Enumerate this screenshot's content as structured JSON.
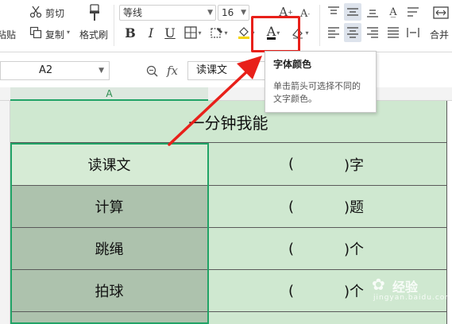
{
  "ribbon": {
    "cut_label": "剪切",
    "paste_label": "粘贴",
    "copy_label": "复制",
    "format_painter_label": "格式刷",
    "font_name": "等线",
    "font_size": "16",
    "merge_label": "合并"
  },
  "tooltip": {
    "title": "字体颜色",
    "description_line1": "单击箭头可选择不同的",
    "description_line2": "文字颜色。"
  },
  "formula_bar": {
    "cell_ref": "A2",
    "formula_value": "读课文"
  },
  "grid": {
    "column_header": "A",
    "title": "一分钟我能",
    "rows": [
      {
        "label": "读课文",
        "left_paren": "(",
        "right_paren_unit": ")字"
      },
      {
        "label": "计算",
        "left_paren": "(",
        "right_paren_unit": ")题"
      },
      {
        "label": "跳绳",
        "left_paren": "(",
        "right_paren_unit": ")个"
      },
      {
        "label": "拍球",
        "left_paren": "(",
        "right_paren_unit": ")个"
      }
    ]
  },
  "watermark": {
    "text": "经验",
    "sub": "jingyan.baidu.com"
  },
  "colors": {
    "highlight_red": "#e8201a",
    "selection_green": "#21a366",
    "cell_green": "#cfe8d0",
    "cell_dark_green": "#adc2ad"
  }
}
